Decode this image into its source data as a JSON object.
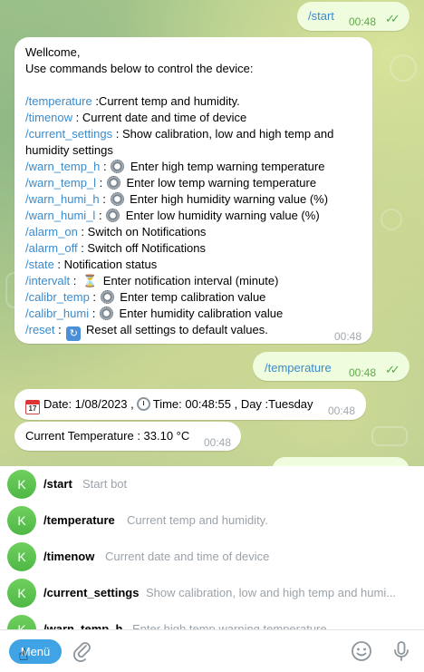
{
  "messages": {
    "start_out": {
      "text": "/start",
      "time": "00:48"
    },
    "welcome": {
      "greeting": "Wellcome,",
      "intro": "Use commands below to control the device:",
      "lines": [
        {
          "cmd": "/temperature",
          "desc": " :Current temp and humidity."
        },
        {
          "cmd": "/timenow",
          "desc": " : Current date and time of device"
        },
        {
          "cmd": "/current_settings",
          "desc": " : Show calibration, low and high temp and"
        },
        {
          "cmd": "",
          "desc": "humidity settings"
        },
        {
          "cmd": "/warn_temp_h",
          "desc": " : ",
          "icon": "gear",
          "after": " Enter high temp warning temperature"
        },
        {
          "cmd": "/warn_temp_l",
          "desc": " : ",
          "icon": "gear",
          "after": " Enter low temp warning temperature"
        },
        {
          "cmd": "/warn_humi_h",
          "desc": " : ",
          "icon": "gear",
          "after": " Enter high humidity warning value (%)"
        },
        {
          "cmd": "/warn_humi_l",
          "desc": " : ",
          "icon": "gear",
          "after": " Enter low humidity warning value (%)"
        },
        {
          "cmd": "/alarm_on",
          "desc": " : Switch on Notifications"
        },
        {
          "cmd": "/alarm_off",
          "desc": " : Switch off Notifications"
        },
        {
          "cmd": "/state",
          "desc": " : Notification status"
        },
        {
          "cmd": "/intervalt",
          "desc": " : ",
          "icon": "hourglass",
          "after": " Enter notification interval (minute)"
        },
        {
          "cmd": "/calibr_temp",
          "desc": " : ",
          "icon": "gear",
          "after": " Enter temp calibration value"
        },
        {
          "cmd": "/calibr_humi",
          "desc": " : ",
          "icon": "gear",
          "after": " Enter humidity calibration value"
        },
        {
          "cmd": "/reset",
          "desc": " : ",
          "icon": "reset",
          "after": " Reset all settings to default values."
        }
      ],
      "time": "00:48"
    },
    "temperature_out": {
      "text": "/temperature",
      "time": "00:48"
    },
    "datetime": {
      "date_label": "Date:  1/08/2023 ,",
      "time_label": "Time: 00:48:55 , Day :Tuesday",
      "time": "00:48"
    },
    "current_temp": {
      "text": "Current Temperature : 33.10 °C",
      "time": "00:48"
    }
  },
  "command_panel": [
    {
      "avatar": "K",
      "name": "/start",
      "desc": "Start bot"
    },
    {
      "avatar": "K",
      "name": "/temperature",
      "desc": "Current temp and humidity."
    },
    {
      "avatar": "K",
      "name": "/timenow",
      "desc": "Current date and time of device"
    },
    {
      "avatar": "K",
      "name": "/current_settings",
      "desc": "Show calibration, low and high temp and humi..."
    },
    {
      "avatar": "K",
      "name": "/warn_temp_h",
      "desc": "Enter high temp warning temperature"
    }
  ],
  "bottom_bar": {
    "menu_label": "Menü",
    "icons": [
      "paperclip-icon",
      "emoji-icon",
      "microphone-icon"
    ]
  },
  "colors": {
    "command_link": "#3a8bcc",
    "outgoing_bubble": "#effdde",
    "menu_button": "#3fa3e5",
    "avatar": "#5cc04f",
    "read_checks": "#4fae4e"
  }
}
